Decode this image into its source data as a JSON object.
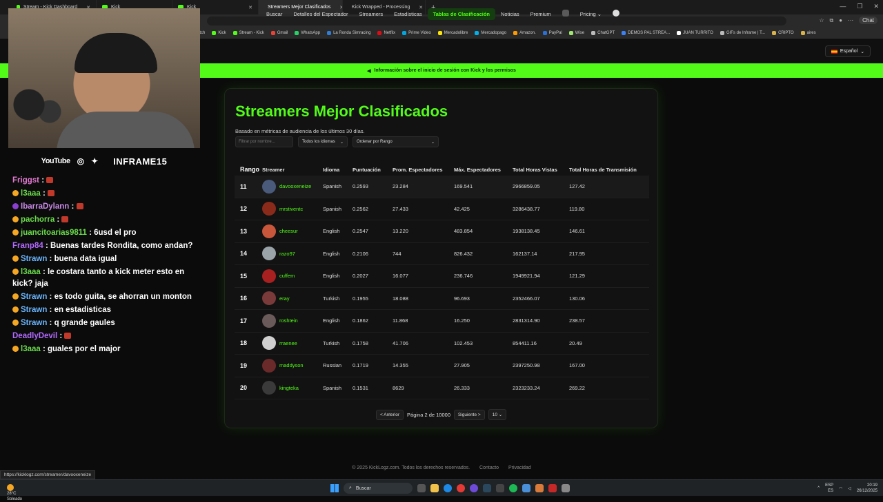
{
  "browser": {
    "tabs": [
      {
        "label": "Stream - Kick Dashboard",
        "active": false
      },
      {
        "label": "Kick",
        "active": false
      },
      {
        "label": "Kick",
        "active": false
      },
      {
        "label": "Streamers Mejor Clasificados",
        "active": true
      },
      {
        "label": "Kick Wrapped - Processing",
        "active": false
      }
    ],
    "chat_label": "Chat",
    "bookmarks": [
      "itch",
      "Kick",
      "Stream - Kick",
      "Gmail",
      "WhatsApp",
      "La Ronda Simracing",
      "Netflix",
      "Prime Video",
      "Mercadolibre",
      "Mercadopago",
      "Amazon.",
      "PayPal",
      "Wise",
      "ChatGPT",
      "DEMOS PAL STREA...",
      "JUAN TURRITO",
      "GIFs de Inframe | T...",
      "CRIPTO",
      "aires"
    ]
  },
  "site_nav": {
    "items": [
      {
        "label": "Buscar",
        "active": false
      },
      {
        "label": "Detalles del Espectador",
        "active": false
      },
      {
        "label": "Streamers",
        "active": false
      },
      {
        "label": "Estadísticas",
        "active": false
      },
      {
        "label": "Tablas de Clasificación",
        "active": true
      },
      {
        "label": "Noticias",
        "active": false
      },
      {
        "label": "Premium",
        "active": false
      }
    ],
    "pricing_label": "Pricing",
    "language_label": "Español"
  },
  "banner": {
    "text": "Información sobre el inicio de sesión con Kick y los permisos"
  },
  "stream_overlay": {
    "youtube_label": "YouTube",
    "brand": "INFRAME15",
    "chat": [
      {
        "user": "Friggst",
        "text": "",
        "color": "#e07ad0",
        "badge": "",
        "emote": true
      },
      {
        "user": "l3aaa",
        "text": "",
        "color": "#6bdc4c",
        "badge": "#f5a623",
        "emote": true
      },
      {
        "user": "IbarraDylann",
        "text": "",
        "color": "#c98ae6",
        "badge": "#8a3fd0",
        "emote": true
      },
      {
        "user": "pachorra",
        "text": "",
        "color": "#6bdc4c",
        "badge": "#f5a623",
        "emote": true
      },
      {
        "user": "juancitoarias9811",
        "text": ": 6usd el pro",
        "color": "#6bdc4c",
        "badge": "#f5a623",
        "emote": false
      },
      {
        "user": "Franp84",
        "text": ": Buenas tardes Rondita, como andan?",
        "color": "#b46bff",
        "badge": "",
        "emote": false
      },
      {
        "user": "Strawn",
        "text": ": buena data igual",
        "color": "#6bb6ff",
        "badge": "#f5a623",
        "emote": false
      },
      {
        "user": "l3aaa",
        "text": ": le costara tanto a kick meter esto en kick? jaja",
        "color": "#6bdc4c",
        "badge": "#f5a623",
        "emote": false
      },
      {
        "user": "Strawn",
        "text": ": es todo guita, se ahorran un monton",
        "color": "#6bb6ff",
        "badge": "#f5a623",
        "emote": false
      },
      {
        "user": "Strawn",
        "text": ": en estadisticas",
        "color": "#6bb6ff",
        "badge": "#f5a623",
        "emote": false
      },
      {
        "user": "Strawn",
        "text": ": q grande gaules",
        "color": "#6bb6ff",
        "badge": "#f5a623",
        "emote": false
      },
      {
        "user": "DeadlyDevil",
        "text": ":",
        "color": "#b46bff",
        "badge": "",
        "emote": true
      },
      {
        "user": "l3aaa",
        "text": ": guales por el major",
        "color": "#6bdc4c",
        "badge": "#f5a623",
        "emote": false
      }
    ]
  },
  "leaderboard": {
    "title": "Streamers Mejor Clasificados",
    "subtitle": "Basado en métricas de audiencia de los últimos 30 días.",
    "filter_placeholder": "Filtrar por nombre...",
    "language_select": "Todos los idiomas",
    "sort_select": "Ordenar por Rango",
    "columns": [
      "Rango",
      "Streamer",
      "Idioma",
      "Puntuación",
      "Prom. Espectadores",
      "Máx. Espectadores",
      "Total Horas Vistas",
      "Total Horas de Transmisión"
    ],
    "rows": [
      {
        "rank": "11",
        "name": "davooxeneize",
        "lang": "Spanish",
        "score": "0.2593",
        "avg": "23.284",
        "max": "169.541",
        "hours": "2966859.05",
        "trans": "127.42",
        "avatar": "#4a5a7a"
      },
      {
        "rank": "12",
        "name": "mrstiventc",
        "lang": "Spanish",
        "score": "0.2562",
        "avg": "27.433",
        "max": "42.425",
        "hours": "3286438.77",
        "trans": "119.80",
        "avatar": "#8a2a1a"
      },
      {
        "rank": "13",
        "name": "cheesur",
        "lang": "English",
        "score": "0.2547",
        "avg": "13.220",
        "max": "483.854",
        "hours": "1938138.45",
        "trans": "146.61",
        "avatar": "#c7563a"
      },
      {
        "rank": "14",
        "name": "razo97",
        "lang": "English",
        "score": "0.2106",
        "avg": "744",
        "max": "826.432",
        "hours": "162137.14",
        "trans": "217.95",
        "avatar": "#9aa3a8"
      },
      {
        "rank": "15",
        "name": "cuffem",
        "lang": "English",
        "score": "0.2027",
        "avg": "16.077",
        "max": "236.746",
        "hours": "1949921.94",
        "trans": "121.29",
        "avatar": "#a82020"
      },
      {
        "rank": "16",
        "name": "eray",
        "lang": "Turkish",
        "score": "0.1955",
        "avg": "18.088",
        "max": "96.693",
        "hours": "2352466.07",
        "trans": "130.06",
        "avatar": "#7a3a3a"
      },
      {
        "rank": "17",
        "name": "roshtein",
        "lang": "English",
        "score": "0.1862",
        "avg": "11.868",
        "max": "16.250",
        "hours": "2831314.90",
        "trans": "238.57",
        "avatar": "#6a5a5a"
      },
      {
        "rank": "18",
        "name": "rraenee",
        "lang": "Turkish",
        "score": "0.1758",
        "avg": "41.706",
        "max": "102.453",
        "hours": "854411.16",
        "trans": "20.49",
        "avatar": "#cfcfcf"
      },
      {
        "rank": "19",
        "name": "maddyson",
        "lang": "Russian",
        "score": "0.1719",
        "avg": "14.355",
        "max": "27.905",
        "hours": "2397250.98",
        "trans": "167.00",
        "avatar": "#6a2a2a"
      },
      {
        "rank": "20",
        "name": "kingteka",
        "lang": "Spanish",
        "score": "0.1531",
        "avg": "8629",
        "max": "26.333",
        "hours": "2323233.24",
        "trans": "269.22",
        "avatar": "#3a3a3a"
      }
    ],
    "pager": {
      "prev": "< Anterior",
      "page_text": "Página 2 de 10000",
      "next": "Siguiente >",
      "page_size": "10"
    }
  },
  "footer": {
    "copyright": "© 2025 KickLogz.com. Todos los derechos reservados.",
    "contact": "Contacto",
    "privacy": "Privacidad"
  },
  "status_url": "https://kicklogz.com/streamer/davooxeneize",
  "taskbar": {
    "temp": "28°C",
    "weather": "Soleado",
    "search": "Buscar",
    "lang1": "ESP",
    "lang2": "ES",
    "time": "20:19",
    "date": "26/12/2025"
  }
}
